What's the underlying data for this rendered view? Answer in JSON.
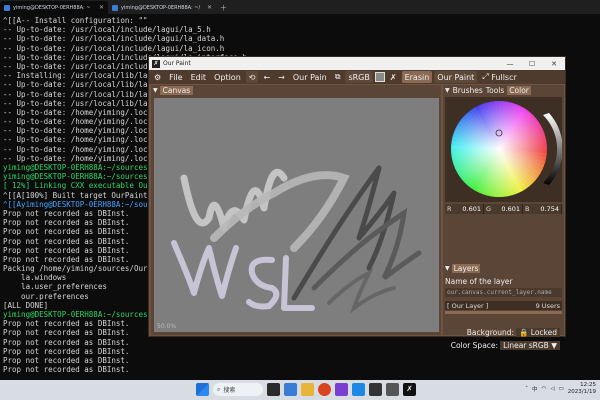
{
  "tabs": [
    {
      "title": "yiming@DESKTOP-0ERH88A: ~",
      "active": true
    },
    {
      "title": "yiming@DESKTOP-0ERH88A: ~/",
      "active": false
    }
  ],
  "terminal_lines": [
    {
      "text": "^[[A-- Install configuration: \"\"",
      "cls": ""
    },
    {
      "text": "-- Up-to-date: /usr/local/include/lagui/la_5.h",
      "cls": ""
    },
    {
      "text": "-- Up-to-date: /usr/local/include/lagui/la_data.h",
      "cls": ""
    },
    {
      "text": "-- Up-to-date: /usr/local/include/lagui/la_icon.h",
      "cls": ""
    },
    {
      "text": "-- Up-to-date: /usr/local/include/lagui/la_interface.h",
      "cls": ""
    },
    {
      "text": "-- Up-to-date: /usr/local/include/lagui/",
      "cls": ""
    },
    {
      "text": "-- Installing: /usr/local/lib/lagui/",
      "cls": ""
    },
    {
      "text": "-- Up-to-date: /usr/local/lib/lagui/",
      "cls": ""
    },
    {
      "text": "-- Up-to-date: /usr/local/lib/lagui/",
      "cls": ""
    },
    {
      "text": "-- Up-to-date: /usr/local/lib/lagui/",
      "cls": ""
    },
    {
      "text": "-- Up-to-date: /home/yiming/.local/",
      "cls": ""
    },
    {
      "text": "-- Up-to-date: /home/yiming/.local/",
      "cls": ""
    },
    {
      "text": "-- Up-to-date: /home/yiming/.local/",
      "cls": ""
    },
    {
      "text": "-- Up-to-date: /home/yiming/.local/",
      "cls": ""
    },
    {
      "text": "-- Up-to-date: /home/yiming/.local/",
      "cls": ""
    },
    {
      "text": "-- Up-to-date: /home/yiming/.local/",
      "cls": ""
    },
    {
      "text": "yiming@DESKTOP-0ERH88A:~/sources/La",
      "cls": "g"
    },
    {
      "text": "yiming@DESKTOP-0ERH88A:~/sources/Our",
      "cls": "g"
    },
    {
      "text": "[ 12%] Linking CXX executable OurPa",
      "cls": "g"
    },
    {
      "text": "^[[A[100%] Built target OurPaint",
      "cls": ""
    },
    {
      "text": "^[[Ayiming@DESKTOP-0ERH88A:~/sources",
      "cls": "b"
    },
    {
      "text": "Prop not recorded as DBInst.",
      "cls": ""
    },
    {
      "text": "Prop not recorded as DBInst.",
      "cls": ""
    },
    {
      "text": "Prop not recorded as DBInst.",
      "cls": ""
    },
    {
      "text": "Prop not recorded as DBInst.",
      "cls": ""
    },
    {
      "text": "Prop not recorded as DBInst.",
      "cls": ""
    },
    {
      "text": "Prop not recorded as DBInst.",
      "cls": ""
    },
    {
      "text": "Packing /home/yiming/sources/OurPain",
      "cls": ""
    },
    {
      "text": "    la.windows",
      "cls": ""
    },
    {
      "text": "    la.user_preferences",
      "cls": ""
    },
    {
      "text": "    our.preferences",
      "cls": ""
    },
    {
      "text": "[ALL DONE]",
      "cls": ""
    },
    {
      "text": "yiming@DESKTOP-0ERH88A:~/sources/Our",
      "cls": "g"
    },
    {
      "text": "Prop not recorded as DBInst.",
      "cls": ""
    },
    {
      "text": "Prop not recorded as DBInst.",
      "cls": ""
    },
    {
      "text": "Prop not recorded as DBInst.",
      "cls": ""
    },
    {
      "text": "Prop not recorded as DBInst.",
      "cls": ""
    },
    {
      "text": "Prop not recorded as DBInst.",
      "cls": ""
    },
    {
      "text": "Prop not recorded as DBInst.",
      "cls": ""
    }
  ],
  "window": {
    "title": "Our Paint",
    "controls": {
      "minimize": "—",
      "maximize": "☐",
      "close": "✕"
    }
  },
  "menu": {
    "file": "File",
    "edit": "Edit",
    "option": "Option",
    "undo_icon": "⟲",
    "back": "←",
    "forward": "→",
    "project": "Our Pain",
    "copy_icon": "⧉",
    "colorspace": "sRGB",
    "tool": "Erasin",
    "brush": "Our Paint",
    "fullscreen": "Fullscr",
    "swatch_color": "#8a8a8a"
  },
  "canvas_panel": {
    "title": "Canvas",
    "zoom": "50.0%"
  },
  "right_panel": {
    "tab_brushes": "Brushes",
    "tab_tools": "Tools",
    "tab_color": "Color",
    "rgb": [
      {
        "label": "R",
        "value": "0.601"
      },
      {
        "label": "G",
        "value": "0.601"
      },
      {
        "label": "B",
        "value": "0.754"
      }
    ],
    "layers_title": "Layers",
    "layer_name_label": "Name of the layer",
    "layer_path": "our.canvas.current_layer.name",
    "layer_row_name": "Our Layer",
    "layer_row_count": "9",
    "layer_row_users": "Users",
    "background_label": "Background:",
    "background_value": "Locked",
    "colorspace_label": "Color Space:",
    "colorspace_value": "Linear sRGB"
  },
  "taskbar": {
    "search_placeholder": "搜索",
    "time": "12:25",
    "date": "2023/1/19",
    "lang": "中"
  },
  "colors": {
    "terminal_bg": "#0c0c0c",
    "prompt_green": "#2fd566",
    "window_brown": "#6e5442",
    "canvas_gray": "#7e7e7e",
    "stroke_light": "#c8c4d6"
  }
}
